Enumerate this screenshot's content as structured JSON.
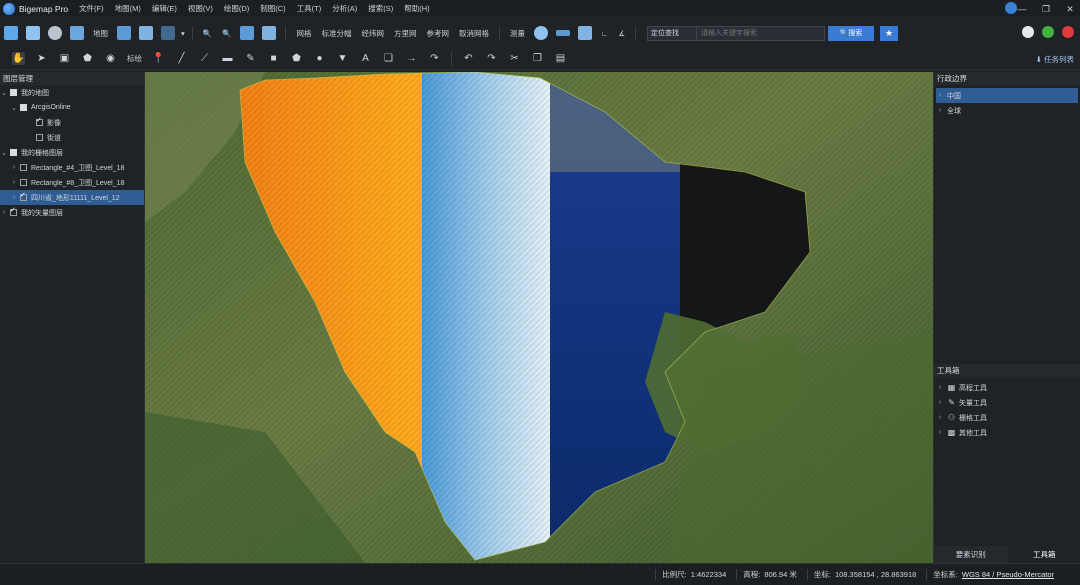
{
  "app": {
    "title": "Bigemap Pro"
  },
  "menu": [
    "文件(F)",
    "地图(M)",
    "编辑(E)",
    "视图(V)",
    "绘图(D)",
    "制图(C)",
    "工具(T)",
    "分析(A)",
    "搜索(S)",
    "帮助(H)"
  ],
  "toolbar1": {
    "map_label": "地图",
    "items": [
      "网格",
      "标准分幅",
      "经纬网",
      "方里网",
      "参考网",
      "取消网格"
    ],
    "measure_label": "测量",
    "search_mode": "定位查找",
    "search_placeholder": "请输入关键字搜索",
    "search_button": "搜索"
  },
  "toolbar2": {
    "mark_label": "标绘",
    "task_list": "任务列表"
  },
  "left_panel": {
    "title": "图层管理",
    "tree": [
      {
        "label": "我的地图",
        "level": 0
      },
      {
        "label": "ArcgisOnline",
        "level": 1
      },
      {
        "label": "影像",
        "level": 2
      },
      {
        "label": "街道",
        "level": 2
      },
      {
        "label": "我的栅格图层",
        "level": 0
      },
      {
        "label": "Rectangle_#4_卫图_Level_18",
        "level": 1
      },
      {
        "label": "Rectangle_#8_卫图_Level_18",
        "level": 1
      },
      {
        "label": "四川省_地形11111_Level_12",
        "level": 1
      },
      {
        "label": "我的矢量图层",
        "level": 0
      }
    ]
  },
  "right_panel": {
    "admin_title": "行政边界",
    "admin_items": [
      "中国",
      "全球"
    ],
    "toolbox_title": "工具箱",
    "tools": [
      "高程工具",
      "矢量工具",
      "栅格工具",
      "其他工具"
    ],
    "tabs": [
      "要素识别",
      "工具箱"
    ]
  },
  "status": {
    "scale_label": "比例尺:",
    "scale_value": "1:4622334",
    "elevation_label": "高程:",
    "elevation_value": "806.94 米",
    "coord_label": "坐标:",
    "coord_value": "108.358154 , 28.863918",
    "crs_label": "坐标系:",
    "crs_value": "WGS 84 / Pseudo-Mercator"
  },
  "colors": {
    "accent": "#3a7bd5",
    "selection": "#2f5d93",
    "panel_bg": "#1f2226"
  }
}
